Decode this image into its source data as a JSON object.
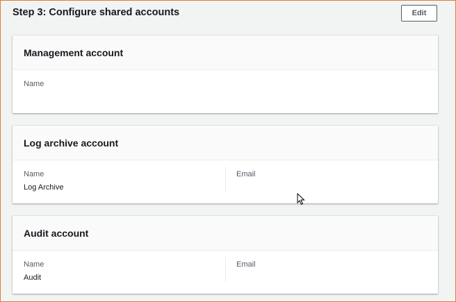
{
  "step": {
    "title": "Step 3: Configure shared accounts",
    "edit_label": "Edit"
  },
  "management_account": {
    "title": "Management account",
    "name_label": "Name",
    "name_value": ""
  },
  "log_archive_account": {
    "title": "Log archive account",
    "name_label": "Name",
    "name_value": "Log Archive",
    "email_label": "Email",
    "email_value": ""
  },
  "audit_account": {
    "title": "Audit account",
    "name_label": "Name",
    "name_value": "Audit",
    "email_label": "Email",
    "email_value": ""
  }
}
